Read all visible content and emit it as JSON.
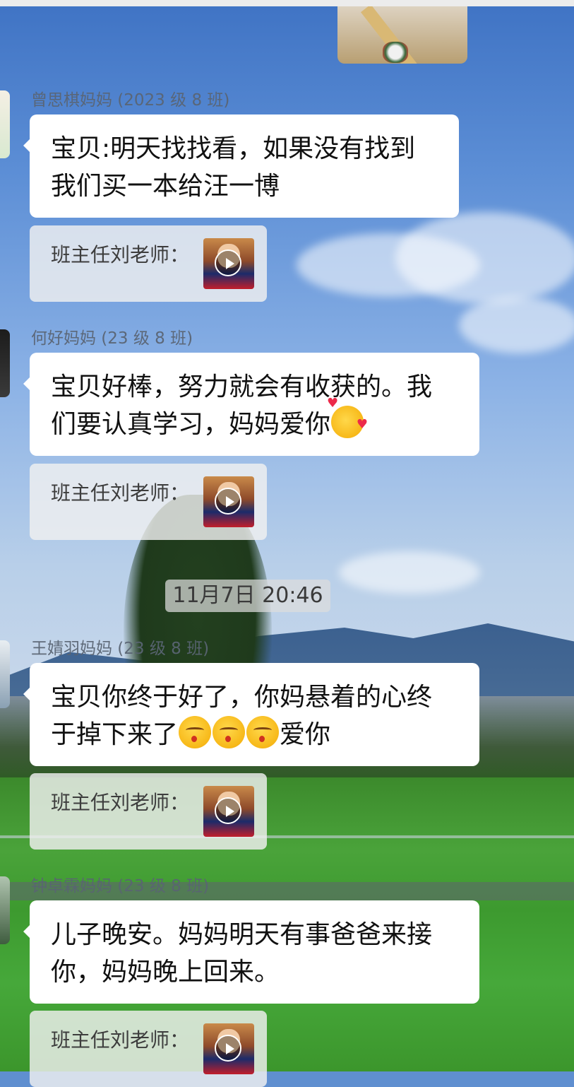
{
  "timestamp": "11月7日 20:46",
  "messages": [
    {
      "sender": "曾思棋妈妈 (2023 级 8 班)",
      "line1": "宝贝:明天找找看，如果没有找到",
      "line2": "我们买一本给汪一博",
      "quote_label": "班主任刘老师："
    },
    {
      "sender": "何好妈妈 (23 级 8 班)",
      "line1": "宝贝好棒，努力就会有收获的。我",
      "line2": "们要认真学习，妈妈爱你",
      "emoji_line2": [
        "smiling-face-with-hearts"
      ],
      "quote_label": "班主任刘老师："
    },
    {
      "sender": "王婧羽妈妈 (23 级 8 班)",
      "line1": "宝贝你终于好了，你妈悬着的心终",
      "line2_prefix": "于掉下来了",
      "emoji_line2": [
        "kissing-face",
        "kissing-face",
        "kissing-face"
      ],
      "line2_suffix": "爱你",
      "quote_label": "班主任刘老师："
    },
    {
      "sender": "钟卓霖妈妈 (23 级 8 班)",
      "line1": "儿子晚安。妈妈明天有事爸爸来接",
      "line2": "你，妈妈晚上回来。",
      "quote_label": "班主任刘老师："
    }
  ],
  "icons": {
    "play": "play-icon"
  },
  "colors": {
    "bubble": "#ffffff",
    "quote_bg": "#f0f0f0",
    "sender_text": "#5a6473",
    "timestamp_bg": "#dcdcdc"
  }
}
